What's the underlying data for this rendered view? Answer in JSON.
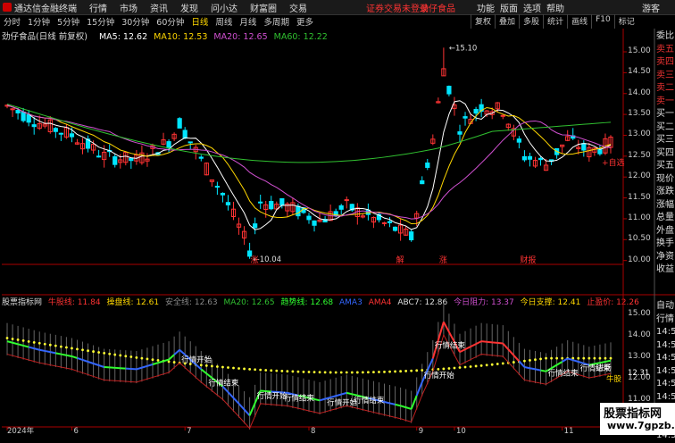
{
  "app_title": "通达信金融终端",
  "menu": [
    "行情",
    "市场",
    "资讯",
    "发现",
    "问小达",
    "财富圈",
    "交易"
  ],
  "notice": "证券交易未登录",
  "stock_name_top": "劲仔食品",
  "sys_menu": [
    "功能",
    "版面",
    "选项",
    "帮助"
  ],
  "user": "游客",
  "periods": [
    "分时",
    "1分钟",
    "5分钟",
    "15分钟",
    "30分钟",
    "60分钟",
    "日线",
    "周线",
    "月线",
    "多周期",
    "更多"
  ],
  "active_period": "日线",
  "toolbar": [
    "复权",
    "叠加",
    "多股",
    "统计",
    "画线",
    "F10",
    "标记"
  ],
  "chart_title": "劲仔食品(日线 前复权)",
  "ma": {
    "ma5": "MA5: 12.62",
    "ma10": "MA10: 12.53",
    "ma20": "MA20: 12.65",
    "ma60": "MA60: 12.22"
  },
  "colors": {
    "up": "#ff3333",
    "down": "#00e5ff",
    "ma5": "#ffffff",
    "ma10": "#ffd700",
    "ma20": "#d050d0",
    "ma60": "#30c030",
    "yellow_dots": "#ffff33"
  },
  "price_axis": [
    "15.00",
    "14.50",
    "14.00",
    "13.50",
    "13.00",
    "12.50",
    "12.00",
    "11.50",
    "11.00",
    "10.50",
    "10.00"
  ],
  "high_label": "15.10",
  "low_label": "10.04",
  "auto_select": "+自选",
  "right_panel": [
    "委比",
    "卖五",
    "卖四",
    "卖三",
    "卖二",
    "卖一",
    "买一",
    "买二",
    "买三",
    "买四",
    "买五",
    "现价",
    "涨跌",
    "涨幅",
    "总量",
    "外盘",
    "换手",
    "净资",
    "收益"
  ],
  "right_panel2": [
    "自动",
    "行情",
    "14:5",
    "14:5",
    "14:5",
    "14:5",
    "14:5",
    "14:5",
    "14:5",
    "14:5",
    "14:5"
  ],
  "markers": [
    "涨",
    "解",
    "涨",
    "财报"
  ],
  "ind_legend": {
    "name": "股票指标网",
    "niuzong": "牛股线: 11.84",
    "caopan": "操盘线: 12.61",
    "anquan": "安全线: 12.63",
    "ma20": "MA20: 12.65",
    "qushi": "趋势线: 12.68",
    "ama3": "AMA3",
    "ama4": "AMA4",
    "abc7": "ABC7: 12.86",
    "zuli": "今日阻力: 13.37",
    "zhicheng": "今日支撑: 12.41",
    "zhisun": "止盈价: 12.26"
  },
  "ind_axis": [
    "15.00",
    "14.00",
    "13.00",
    "12.00",
    "11.00",
    "10.00"
  ],
  "ind_current": "12.31",
  "annotations": [
    "行情开始",
    "行情结束",
    "行情开始",
    "行情结束",
    "行情开始",
    "行情结束",
    "行情开始",
    "行情结束",
    "行情开始",
    "行情结束",
    "进场",
    "牛股"
  ],
  "date_axis": [
    "2024年",
    "6",
    "7",
    "8",
    "9",
    "10",
    "11"
  ],
  "watermark": {
    "line1": "股票指标网",
    "line2": "www.7gpzb.com"
  }
}
